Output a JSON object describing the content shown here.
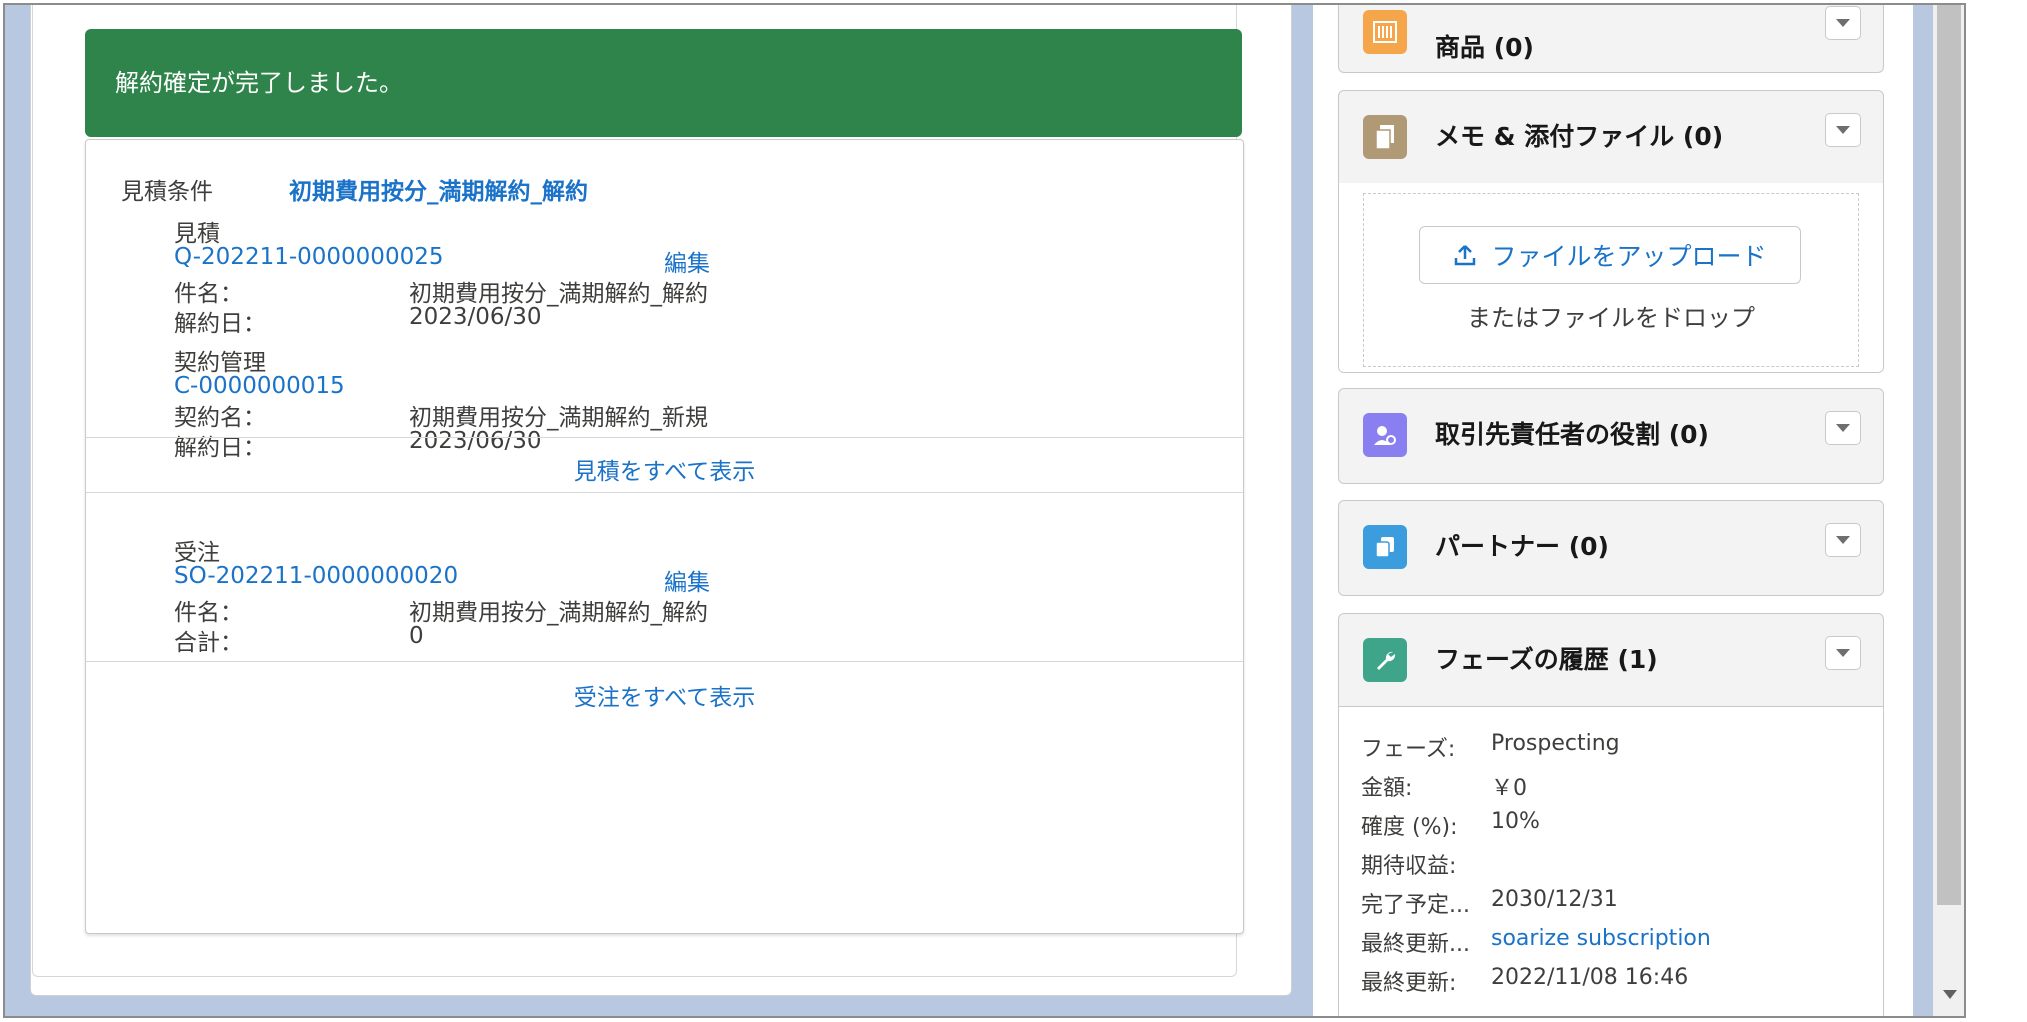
{
  "toast": {
    "message": "解約確定が完了しました。"
  },
  "quote_section": {
    "condition_label": "見積条件",
    "condition_value": "初期費用按分_満期解約_解約",
    "quote": {
      "heading": "見積",
      "number": "Q-202211-0000000025",
      "edit_label": "編集",
      "name_label": "件名：",
      "name_value": "初期費用按分_満期解約_解約",
      "date_label": "解約日：",
      "date_value": "2023/06/30"
    },
    "contract": {
      "heading": "契約管理",
      "number": "C-0000000015",
      "name_label": "契約名：",
      "name_value": "初期費用按分_満期解約_新規",
      "date_label": "解約日：",
      "date_value": "2023/06/30"
    },
    "view_all_quotes": "見積をすべて表示"
  },
  "order_section": {
    "heading": "受注",
    "number": "SO-202211-0000000020",
    "edit_label": "編集",
    "name_label": "件名：",
    "name_value": "初期費用按分_満期解約_解約",
    "total_label": "合計：",
    "total_value": "0",
    "view_all_orders": "受注をすべて表示"
  },
  "sidebar": {
    "products": {
      "title": "商品 (0)",
      "icon": "products-icon",
      "color": "#f5a64b"
    },
    "notes": {
      "title": "メモ & 添付ファイル (0)",
      "icon": "document-icon",
      "color": "#b09a76",
      "upload_label": "ファイルをアップロード",
      "drop_text": "またはファイルをドロップ"
    },
    "contact_roles": {
      "title": "取引先責任者の役割 (0)",
      "icon": "contact-role-icon",
      "color": "#8a7ff0"
    },
    "partners": {
      "title": "パートナー (0)",
      "icon": "partner-icon",
      "color": "#3b9ddd"
    },
    "stage_history": {
      "title": "フェーズの履歴 (1)",
      "icon": "wrench-icon",
      "color": "#3fa58a",
      "rows": [
        {
          "label": "フェーズ:",
          "value": "Prospecting"
        },
        {
          "label": "金額:",
          "value": "￥0"
        },
        {
          "label": "確度 (%):",
          "value": "10%"
        },
        {
          "label": "期待収益:",
          "value": ""
        },
        {
          "label": "完了予定...",
          "value": "2030/12/31"
        },
        {
          "label": "最終更新...",
          "value": "soarize subscription",
          "link": true
        },
        {
          "label": "最終更新:",
          "value": "2022/11/08 16:46"
        }
      ]
    }
  }
}
